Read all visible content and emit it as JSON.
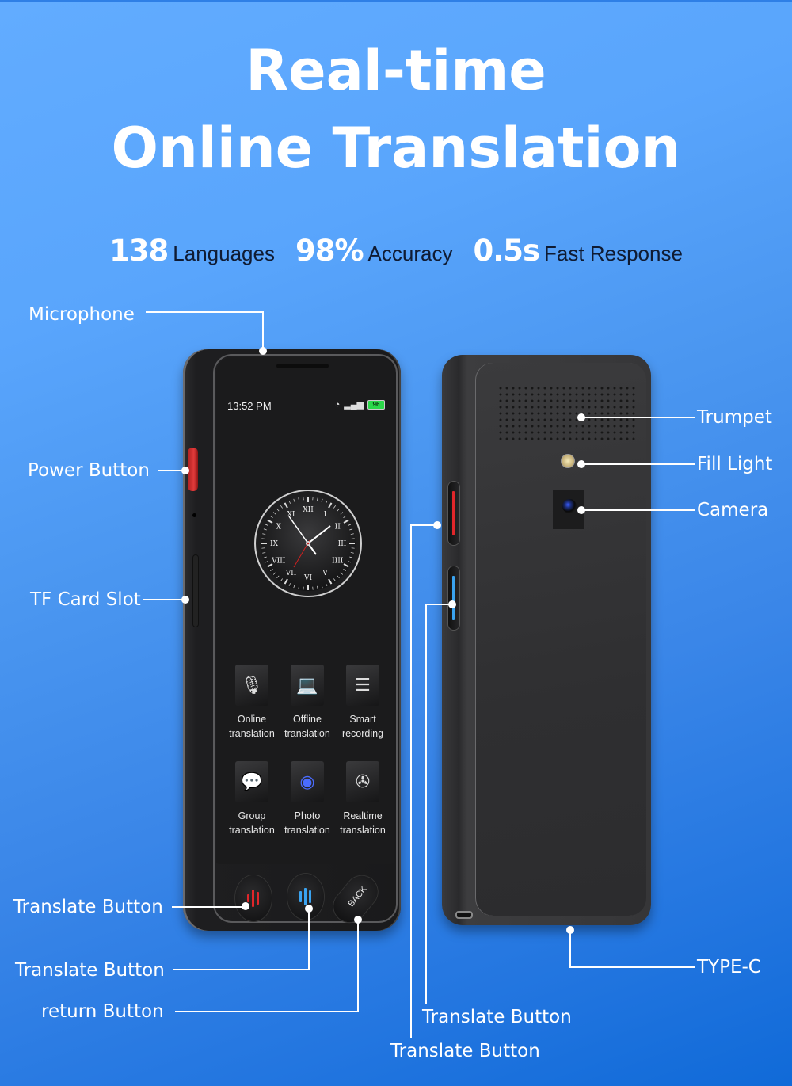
{
  "headline": {
    "line1": "Real-time",
    "line2": "Online Translation"
  },
  "stats": [
    {
      "value": "138",
      "label": "Languages"
    },
    {
      "value": "98%",
      "label": "Accuracy"
    },
    {
      "value": "0.5s",
      "label": "Fast Response"
    }
  ],
  "callouts": {
    "microphone": "Microphone",
    "power_button": "Power Button",
    "tf_card_slot": "TF Card Slot",
    "translate_button_1": "Translate Button",
    "translate_button_2": "Translate Button",
    "return_button": "return  Button",
    "trumpet": "Trumpet",
    "fill_light": "Fill Light",
    "camera": "Camera",
    "type_c": "TYPE-C",
    "side_translate_button_1": "Translate Button",
    "side_translate_button_2": "Translate Button"
  },
  "screen": {
    "time": "13:52 PM",
    "battery": "96",
    "clock_numerals": [
      "XII",
      "I",
      "II",
      "III",
      "IIII",
      "V",
      "VI",
      "VII",
      "VIII",
      "IX",
      "X",
      "XI"
    ],
    "apps": [
      {
        "icon": "microphone-icon",
        "glyph": "🎙",
        "label_line1": "Online",
        "label_line2": "translation"
      },
      {
        "icon": "laptop-cloud-icon",
        "glyph": "💻",
        "label_line1": "Offline",
        "label_line2": "translation"
      },
      {
        "icon": "recorder-icon",
        "glyph": "☰",
        "label_line1": "Smart",
        "label_line2": "recording"
      },
      {
        "icon": "chat-bubbles-icon",
        "glyph": "💬",
        "label_line1": "Group",
        "label_line2": "translation"
      },
      {
        "icon": "camera-lens-icon",
        "glyph": "◉",
        "label_line1": "Photo",
        "label_line2": "translation"
      },
      {
        "icon": "film-reel-icon",
        "glyph": "✇",
        "label_line1": "Realtime",
        "label_line2": "translation"
      }
    ],
    "back_label": "BACK"
  },
  "colors": {
    "accent_red": "#e0262a",
    "accent_blue": "#3aa3f0",
    "stat_label": "#0f1b33"
  }
}
